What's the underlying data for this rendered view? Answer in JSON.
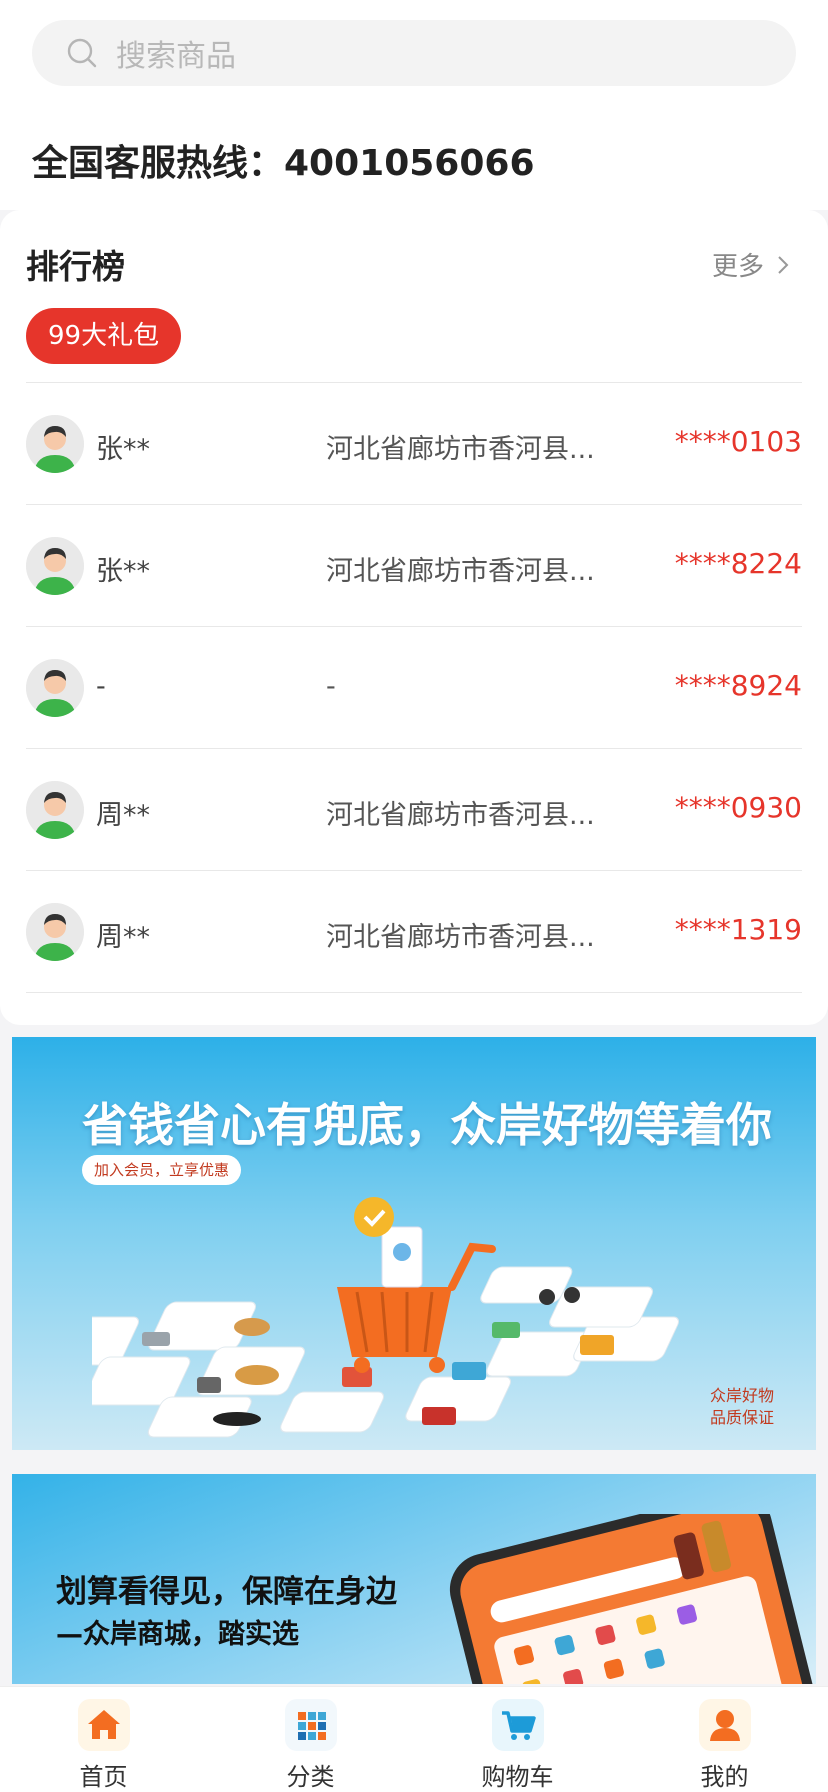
{
  "search": {
    "placeholder": "搜索商品"
  },
  "hotline": "全国客服热线：4001056066",
  "ranking": {
    "title": "排行榜",
    "more": "更多",
    "tag": "99大礼包",
    "rows": [
      {
        "name": "张**",
        "address": "河北省廊坊市香河县...",
        "phone": "****0103"
      },
      {
        "name": "张**",
        "address": "河北省廊坊市香河县...",
        "phone": "****8224"
      },
      {
        "name": "-",
        "address": "-",
        "phone": "****8924"
      },
      {
        "name": "周**",
        "address": "河北省廊坊市香河县...",
        "phone": "****0930"
      },
      {
        "name": "周**",
        "address": "河北省廊坊市香河县...",
        "phone": "****1319"
      }
    ]
  },
  "banner1": {
    "title": "省钱省心有兜底，众岸好物等着你",
    "pill": "加入会员，立享优惠",
    "caption_line1": "众岸好物",
    "caption_line2": "品质保证"
  },
  "banner2": {
    "line1": "划算看得见，保障在身边",
    "line2": "—众岸商城，踏实选"
  },
  "tabbar": {
    "items": [
      {
        "label": "首页",
        "icon": "home-icon"
      },
      {
        "label": "分类",
        "icon": "category-icon"
      },
      {
        "label": "购物车",
        "icon": "cart-icon"
      },
      {
        "label": "我的",
        "icon": "user-icon"
      }
    ]
  },
  "colors": {
    "accent": "#e6352b",
    "brand_orange": "#f36d21"
  }
}
